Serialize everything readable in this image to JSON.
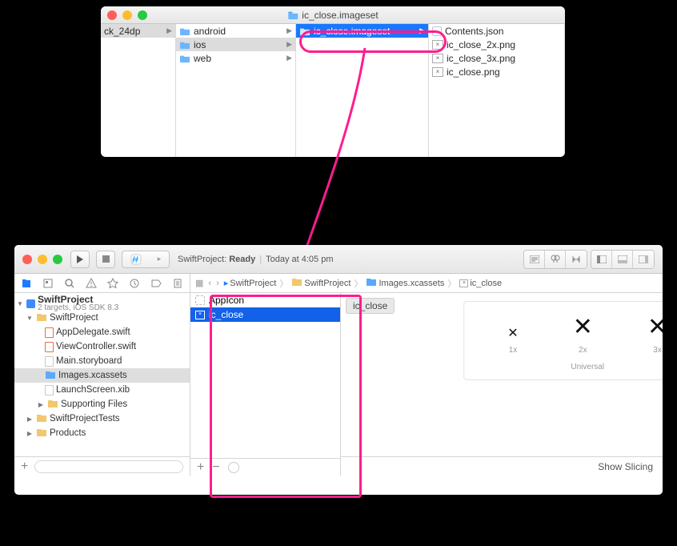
{
  "finder": {
    "title": "ic_close.imageset",
    "col1": {
      "item": "ck_24dp"
    },
    "col2": [
      "android",
      "ios",
      "web"
    ],
    "col3": {
      "item": "ic_close.imageset"
    },
    "col4": [
      "Contents.json",
      "ic_close_2x.png",
      "ic_close_3x.png",
      "ic_close.png"
    ]
  },
  "xcode": {
    "status_name": "SwiftProject:",
    "status_state": "Ready",
    "status_time": "Today at 4:05 pm",
    "project_title": "SwiftProject",
    "project_sub": "2 targets, iOS SDK 8.3",
    "tree": {
      "grp": "SwiftProject",
      "files": [
        "AppDelegate.swift",
        "ViewController.swift",
        "Main.storyboard",
        "Images.xcassets",
        "LaunchScreen.xib"
      ],
      "support": "Supporting Files",
      "tests": "SwiftProjectTests",
      "products": "Products"
    },
    "crumbs": [
      "SwiftProject",
      "SwiftProject",
      "Images.xcassets",
      "ic_close"
    ],
    "assets": {
      "appicon": "AppIcon",
      "icclose": "ic_close"
    },
    "slot_title": "ic_close",
    "slots": {
      "s1": "1x",
      "s2": "2x",
      "s3": "3x",
      "universal": "Universal"
    },
    "show_slicing": "Show Slicing"
  }
}
